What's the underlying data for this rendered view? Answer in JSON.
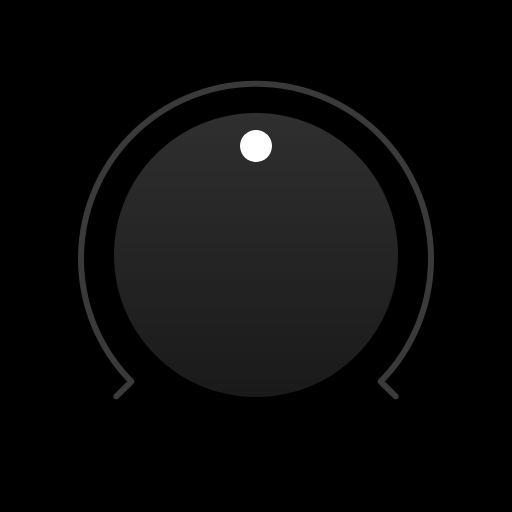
{
  "knob": {
    "value_fraction": 0.5,
    "colors": {
      "background": "#000000",
      "track": "#3a3a3a",
      "body_top": "#2f2f2f",
      "body_bottom": "#1a1a1a",
      "indicator": "#ffffff"
    },
    "icons": {
      "knob": "rotary-knob",
      "indicator": "indicator-dot"
    }
  }
}
